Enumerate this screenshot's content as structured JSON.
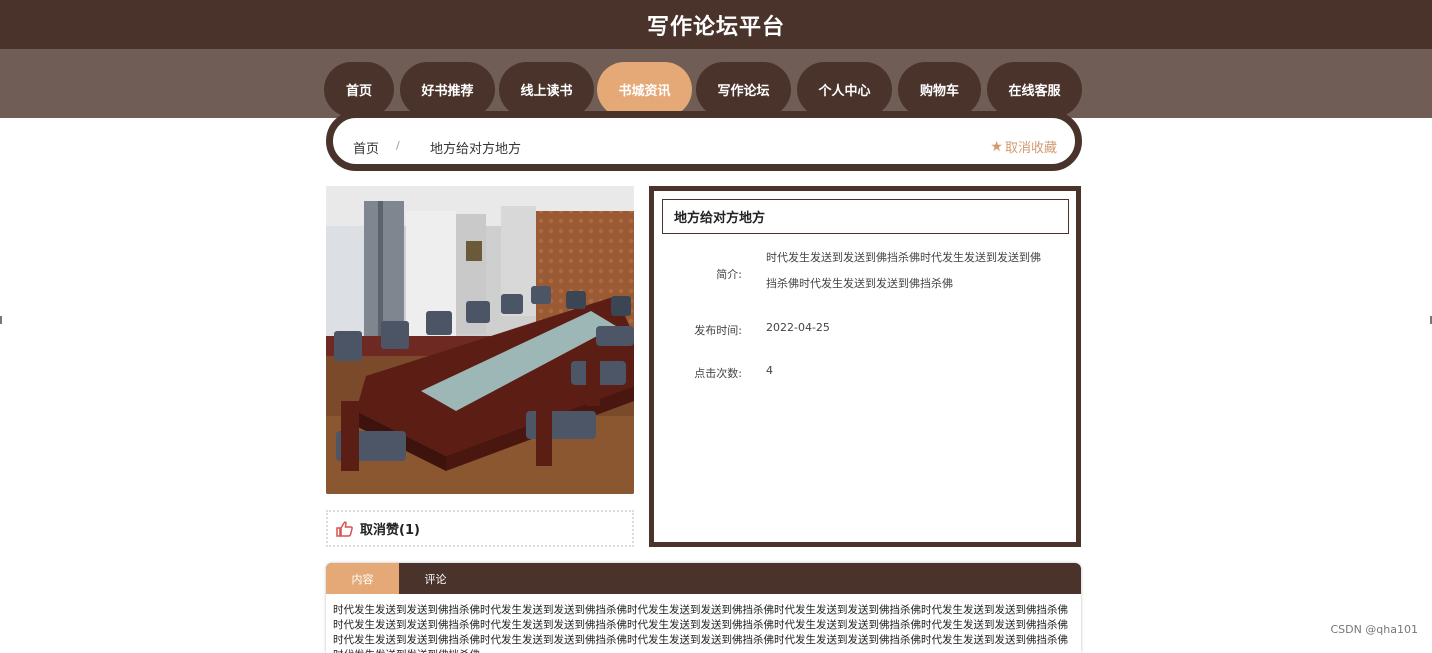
{
  "header": {
    "title": "写作论坛平台"
  },
  "nav": {
    "items": [
      {
        "label": "首页"
      },
      {
        "label": "好书推荐"
      },
      {
        "label": "线上读书"
      },
      {
        "label": "书城资讯"
      },
      {
        "label": "写作论坛"
      },
      {
        "label": "个人中心"
      },
      {
        "label": "购物车"
      },
      {
        "label": "在线客服"
      }
    ],
    "active": "书城资讯"
  },
  "breadcrumb": {
    "home": "首页",
    "separator": "/",
    "current": "地方给对方地方"
  },
  "favorite_button": {
    "icon": "star-icon",
    "label": "取消收藏"
  },
  "like": {
    "icon": "thumbs-up-icon",
    "label": "取消赞(1)"
  },
  "article": {
    "title": "地方给对方地方",
    "summary_label": "简介:",
    "summary_line1": "时代发生发送到发送到佛挡杀佛时代发生发送到发送到佛",
    "summary_line2": "挡杀佛时代发生发送到发送到佛挡杀佛",
    "publish_label": "发布时间:",
    "publish_value": "2022-04-25",
    "clicks_label": "点击次数:",
    "clicks_value": "4"
  },
  "tabs": [
    {
      "label": "内容"
    },
    {
      "label": "评论"
    }
  ],
  "content_text": "时代发生发送到发送到佛挡杀佛时代发生发送到发送到佛挡杀佛时代发生发送到发送到佛挡杀佛时代发生发送到发送到佛挡杀佛时代发生发送到发送到佛挡杀佛时代发生发送到发送到佛挡杀佛时代发生发送到发送到佛挡杀佛时代发生发送到发送到佛挡杀佛时代发生发送到发送到佛挡杀佛时代发生发送到发送到佛挡杀佛时代发生发送到发送到佛挡杀佛时代发生发送到发送到佛挡杀佛时代发生发送到发送到佛挡杀佛时代发生发送到发送到佛挡杀佛时代发生发送到发送到佛挡杀佛时代发生发送到发送到佛挡杀佛",
  "watermark": "CSDN @qha101",
  "colors": {
    "dark_brown": "#4a332b",
    "nav_band": "#6f5d56",
    "accent_peach": "#e5a978",
    "favorite_text": "#d29a70"
  }
}
